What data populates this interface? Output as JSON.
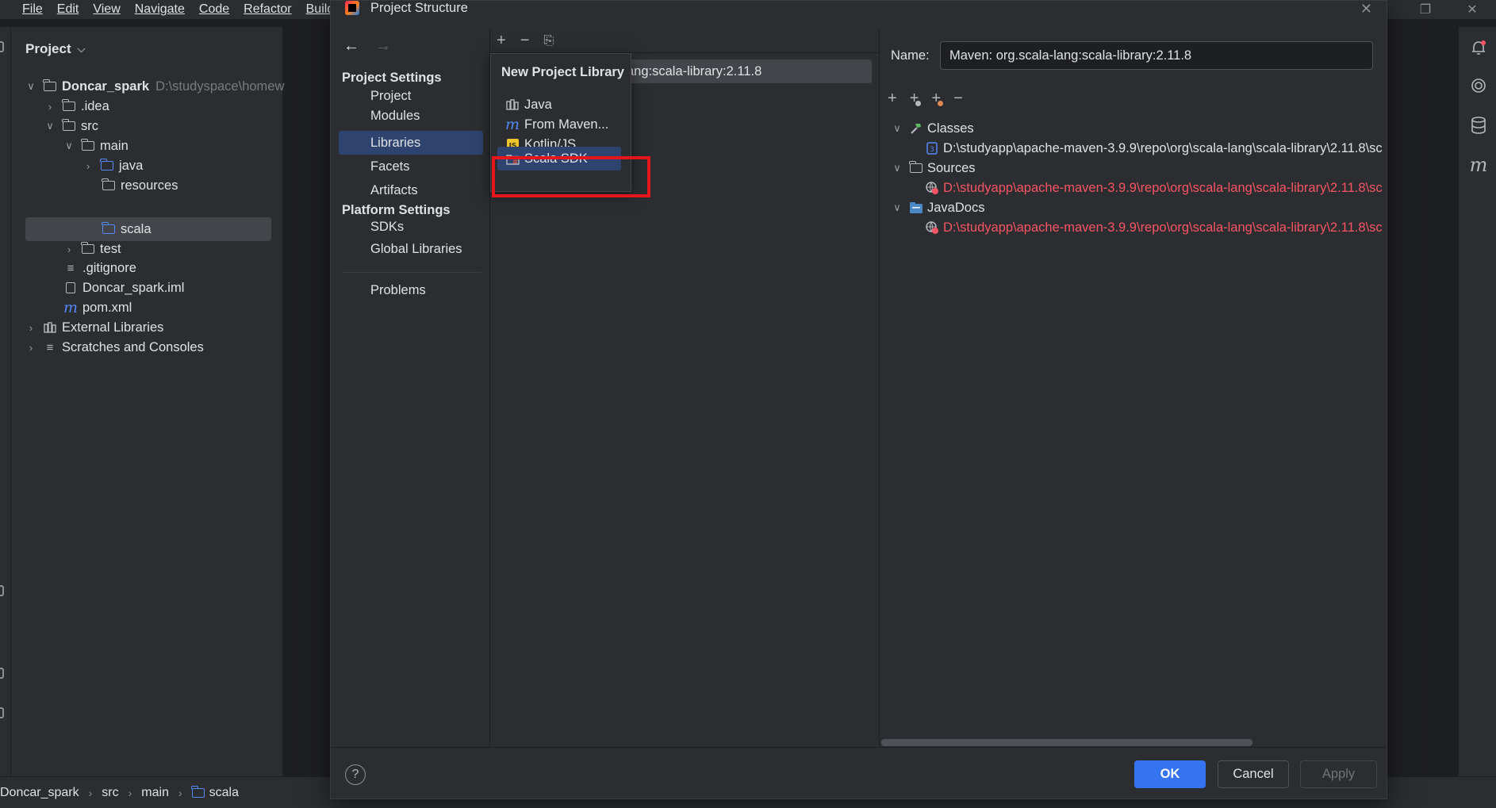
{
  "menubar": {
    "items": [
      {
        "label": "File"
      },
      {
        "label": "Edit"
      },
      {
        "label": "View"
      },
      {
        "label": "Navigate"
      },
      {
        "label": "Code"
      },
      {
        "label": "Refactor"
      },
      {
        "label": "Build"
      }
    ]
  },
  "project_panel": {
    "title": "Project",
    "tree": [
      {
        "label": "Doncar_spark",
        "path": "D:\\studyspace\\homew",
        "icon": "module-folder-icon"
      },
      {
        "label": ".idea",
        "icon": "folder-icon"
      },
      {
        "label": "src",
        "icon": "folder-icon"
      },
      {
        "label": "main",
        "icon": "folder-icon"
      },
      {
        "label": "java",
        "icon": "source-folder-icon"
      },
      {
        "label": "resources",
        "icon": "resources-folder-icon"
      },
      {
        "label": "scala",
        "icon": "source-folder-icon",
        "selected": true
      },
      {
        "label": "test",
        "icon": "folder-icon"
      },
      {
        "label": ".gitignore",
        "icon": "text-file-icon"
      },
      {
        "label": "Doncar_spark.iml",
        "icon": "iml-file-icon"
      },
      {
        "label": "pom.xml",
        "icon": "maven-icon"
      },
      {
        "label": "External Libraries",
        "icon": "library-icon"
      },
      {
        "label": "Scratches and Consoles",
        "icon": "scratches-icon"
      }
    ]
  },
  "statusbar": {
    "breadcrumbs": [
      "Doncar_spark",
      "src",
      "main",
      "scala"
    ]
  },
  "dialog": {
    "title": "Project Structure",
    "nav": {
      "project_settings_header": "Project Settings",
      "project_settings": [
        {
          "label": "Project"
        },
        {
          "label": "Modules"
        },
        {
          "label": "Libraries",
          "selected": true
        },
        {
          "label": "Facets"
        },
        {
          "label": "Artifacts"
        }
      ],
      "platform_settings_header": "Platform Settings",
      "platform_settings": [
        {
          "label": "SDKs"
        },
        {
          "label": "Global Libraries"
        }
      ],
      "problems": "Problems"
    },
    "library_list": {
      "visible_entry": "ang:scala-library:2.11.8"
    },
    "popup": {
      "title": "New Project Library",
      "items": [
        {
          "label": "Java",
          "icon": "library-icon"
        },
        {
          "label": "From Maven...",
          "icon": "maven-icon"
        },
        {
          "label": "Kotlin/JS",
          "icon": "kotlin-js-icon"
        },
        {
          "label": "Scala SDK",
          "icon": "scala-sdk-icon",
          "selected": true
        }
      ]
    },
    "details": {
      "name_label": "Name:",
      "name_value": "Maven: org.scala-lang:scala-library:2.11.8",
      "sections": [
        {
          "label": "Classes",
          "icon": "classes-hammer-icon",
          "path": "D:\\studyapp\\apache-maven-3.9.9\\repo\\org\\scala-lang\\scala-library\\2.11.8\\sc",
          "path_status": "ok"
        },
        {
          "label": "Sources",
          "icon": "sources-folder-icon",
          "path": "D:\\studyapp\\apache-maven-3.9.9\\repo\\org\\scala-lang\\scala-library\\2.11.8\\sc",
          "path_status": "error"
        },
        {
          "label": "JavaDocs",
          "icon": "javadocs-folder-icon",
          "path": "D:\\studyapp\\apache-maven-3.9.9\\repo\\org\\scala-lang\\scala-library\\2.11.8\\sc",
          "path_status": "error"
        }
      ]
    },
    "buttons": {
      "help": "?",
      "ok": "OK",
      "cancel": "Cancel",
      "apply": "Apply"
    }
  },
  "colors": {
    "accent": "#3574f0",
    "selection": "#2e436e",
    "error_path": "#f75464",
    "highlight_box": "#e5151b"
  }
}
